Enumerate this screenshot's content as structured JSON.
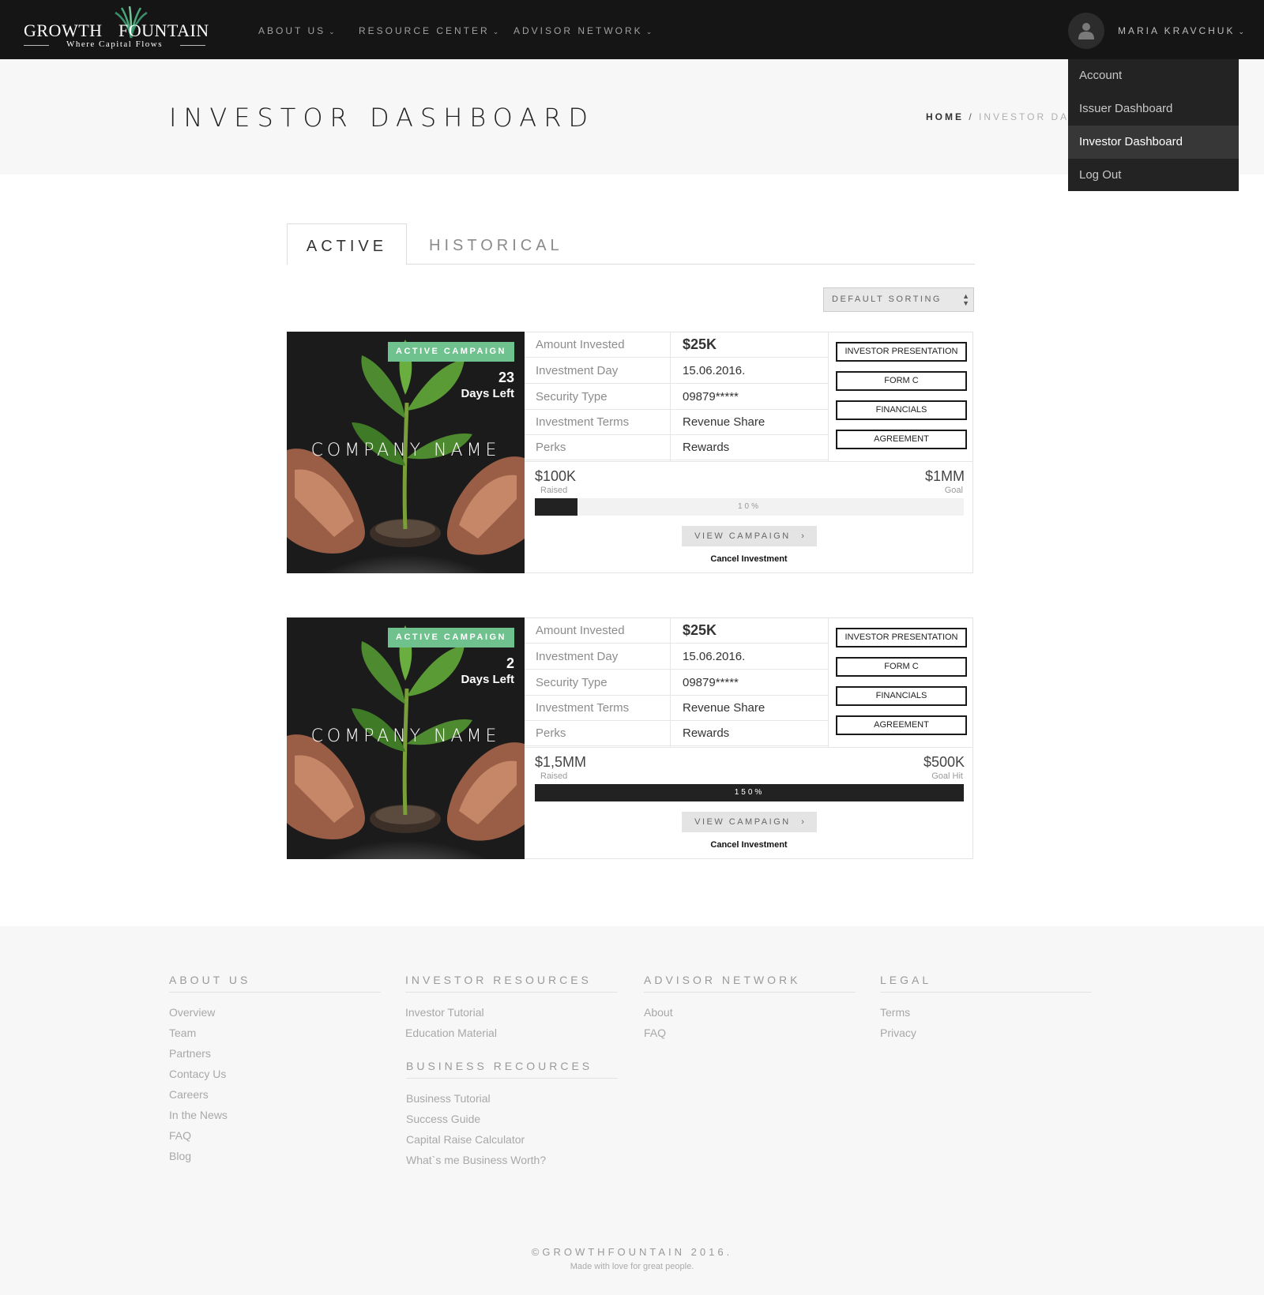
{
  "brand": {
    "name_part1": "GROWTH",
    "name_part2": "FOUNTAIN",
    "tagline": "Where Capital Flows",
    "accent_color": "#6fc18e"
  },
  "nav": {
    "links": [
      {
        "label": "ABOUT US"
      },
      {
        "label": "RESOURCE CENTER"
      },
      {
        "label": "ADVISOR NETWORK"
      }
    ],
    "user_name": "MARIA KRAVCHUK",
    "dropdown": [
      {
        "label": "Account"
      },
      {
        "label": "Issuer Dashboard"
      },
      {
        "label": "Investor Dashboard"
      },
      {
        "label": "Log Out"
      }
    ]
  },
  "header": {
    "title": "INVESTOR DASHBOARD",
    "breadcrumb": {
      "home": "HOME",
      "separator": "/",
      "current": "INVESTOR DASHBOARD"
    }
  },
  "tabs": [
    {
      "label": "ACTIVE"
    },
    {
      "label": "HISTORICAL"
    }
  ],
  "sort": {
    "selected": "DEFAULT SORTING"
  },
  "cards": [
    {
      "badge": "ACTIVE CAMPAIGN",
      "days_num": "23",
      "days_label": "Days Left",
      "company": "COMPANY NAME",
      "details": [
        {
          "label": "Amount Invested",
          "value": "$25K"
        },
        {
          "label": "Investment Day",
          "value": "15.06.2016."
        },
        {
          "label": "Security Type",
          "value": "09879*****"
        },
        {
          "label": "Investment Terms",
          "value": "Revenue Share"
        },
        {
          "label": "Perks",
          "value": "Rewards"
        }
      ],
      "docs": [
        "INVESTOR PRESENTATION",
        "FORM C",
        "FINANCIALS",
        "AGREEMENT"
      ],
      "raised": "$100K",
      "raised_label": "Raised",
      "goal": "$1MM",
      "goal_label": "Goal",
      "progress_text": "10%",
      "progress_fraction": 0.1,
      "view_label": "VIEW CAMPAIGN",
      "cancel_label": "Cancel Investment"
    },
    {
      "badge": "ACTIVE CAMPAIGN",
      "days_num": "2",
      "days_label": "Days Left",
      "company": "COMPANY NAME",
      "details": [
        {
          "label": "Amount Invested",
          "value": "$25K"
        },
        {
          "label": "Investment Day",
          "value": "15.06.2016."
        },
        {
          "label": "Security Type",
          "value": "09879*****"
        },
        {
          "label": "Investment Terms",
          "value": "Revenue Share"
        },
        {
          "label": "Perks",
          "value": "Rewards"
        }
      ],
      "docs": [
        "INVESTOR PRESENTATION",
        "FORM C",
        "FINANCIALS",
        "AGREEMENT"
      ],
      "raised": "$1,5MM",
      "raised_label": "Raised",
      "goal": "$500K",
      "goal_label": "Goal Hit",
      "progress_text": "150%",
      "progress_fraction": 1.0,
      "view_label": "VIEW CAMPAIGN",
      "cancel_label": "Cancel Investment"
    }
  ],
  "footer": {
    "about": {
      "heading": "ABOUT US",
      "links": [
        "Overview",
        "Team",
        "Partners",
        "Contacy Us",
        "Careers",
        "In the News",
        "FAQ",
        "Blog"
      ]
    },
    "investor": {
      "heading": "INVESTOR RESOURCES",
      "links": [
        "Investor Tutorial",
        "Education Material"
      ]
    },
    "business": {
      "heading": "BUSINESS RECOURCES",
      "links": [
        "Business Tutorial",
        "Success Guide",
        "Capital Raise Calculator",
        "What`s me Business Worth?"
      ]
    },
    "advisor": {
      "heading": "ADVISOR NETWORK",
      "links": [
        "About",
        "FAQ"
      ]
    },
    "legal": {
      "heading": "LEGAL",
      "links": [
        "Terms",
        "Privacy"
      ]
    },
    "copyright": "©GROWTHFOUNTAIN 2016.",
    "tagline": "Made with love for great people."
  }
}
